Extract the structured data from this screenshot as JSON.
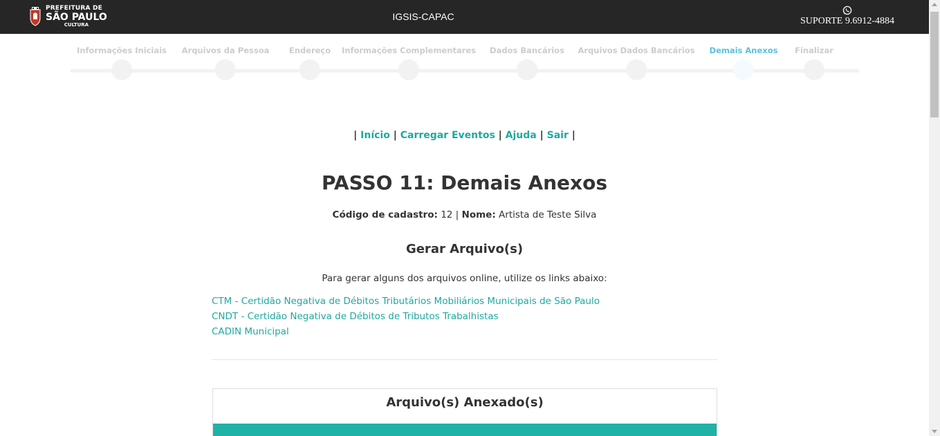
{
  "header": {
    "logo": {
      "line1": "PREFEITURA DE",
      "line2": "SÃO PAULO",
      "line3": "CULTURA"
    },
    "app_title": "IGSIS-CAPAC",
    "support_label": "SUPORTE 9.6912-4884",
    "support_icon": "whatsapp-icon",
    "background": "#262626"
  },
  "wizard": {
    "steps": [
      {
        "label": "Informações Iniciais",
        "active": false
      },
      {
        "label": "Arquivos da Pessoa",
        "active": false
      },
      {
        "label": "Endereço",
        "active": false
      },
      {
        "label": "Informações Complementares",
        "active": false
      },
      {
        "label": "Dados Bancários",
        "active": false
      },
      {
        "label": "Arquivos Dados Bancários",
        "active": false
      },
      {
        "label": "Demais Anexos",
        "active": true
      },
      {
        "label": "Finalizar",
        "active": false
      }
    ],
    "active_color": "#5bc0de"
  },
  "nav": {
    "links": [
      "Início",
      "Carregar Eventos",
      "Ajuda",
      "Sair"
    ],
    "link_color": "#20a89f"
  },
  "page": {
    "heading": "PASSO 11: Demais Anexos",
    "cadastro_label": "Código de cadastro:",
    "cadastro_value": "12",
    "nome_label": "Nome:",
    "nome_value": "Artista de Teste Silva"
  },
  "generate": {
    "heading": "Gerar Arquivo(s)",
    "instruction": "Para gerar alguns dos arquivos online, utilize os links abaixo:",
    "links": [
      "CTM - Certidão Negativa de Débitos Tributários Mobiliários Municipais de São Paulo",
      "CNDT - Certidão Negativa de Débitos de Tributos Trabalhistas",
      "CADIN Municipal"
    ]
  },
  "attachments": {
    "heading": "Arquivo(s) Anexado(s)",
    "bar_color": "#20b2a6"
  }
}
